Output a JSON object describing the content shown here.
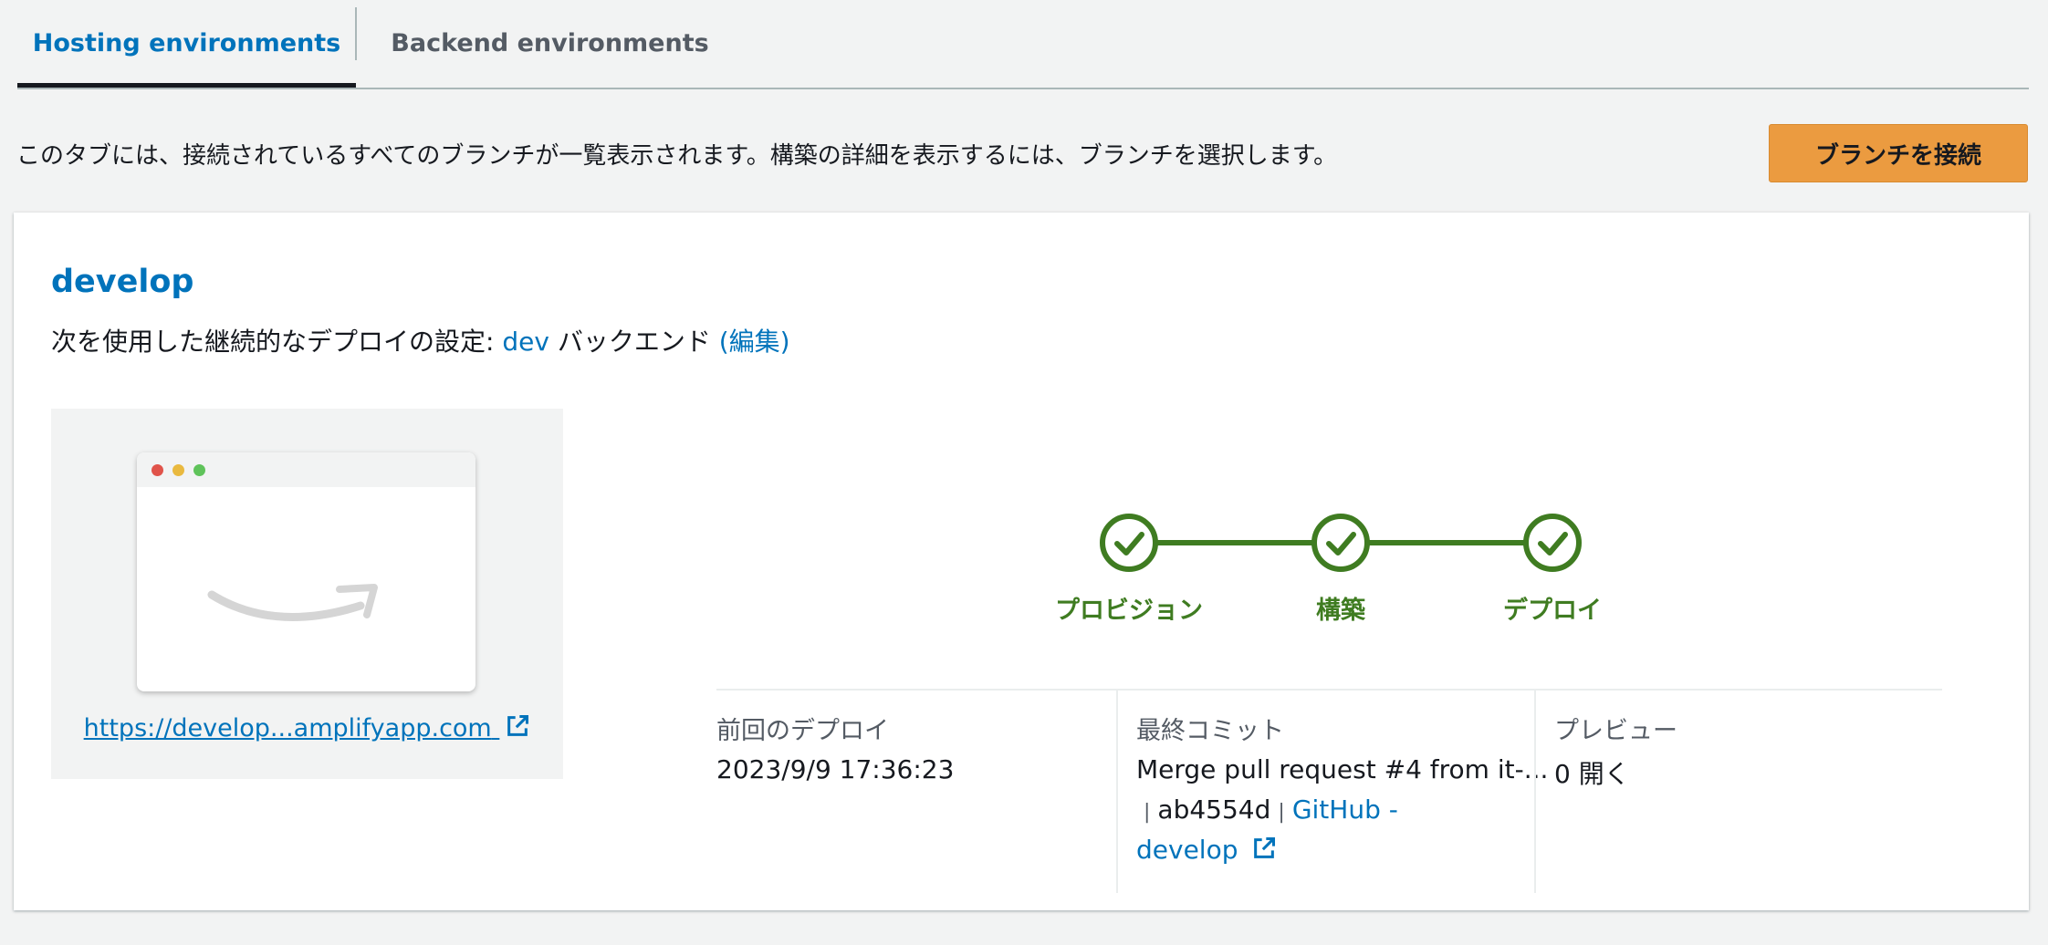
{
  "tabs": {
    "hosting_label": "Hosting environments",
    "backend_label": "Backend environments"
  },
  "intro_text": "このタブには、接続されているすべてのブランチが一覧表示されます。構築の詳細を表示するには、ブランチを選択します。",
  "connect_branch_label": "ブランチを接続",
  "branch": {
    "name": "develop",
    "deploy_prefix": "次を使用した継続的なデプロイの設定: ",
    "backend_link": "dev",
    "backend_suffix": " バックエンド ",
    "edit_label": "(編集)"
  },
  "preview": {
    "url": "https://develop...amplifyapp.com",
    "icon": "external-link-icon"
  },
  "pipeline": {
    "steps": [
      {
        "label": "プロビジョン",
        "status": "success"
      },
      {
        "label": "構築",
        "status": "success"
      },
      {
        "label": "デプロイ",
        "status": "success"
      }
    ],
    "color": "#3f7c21"
  },
  "details": {
    "last_deploy_label": "前回のデプロイ",
    "last_deploy_value": "2023/9/9 17:36:23",
    "last_commit_label": "最終コミット",
    "commit_message": "Merge pull request #4 from it-...",
    "commit_hash": "ab4554d",
    "commit_source_line1": "GitHub -",
    "commit_source_line2": "develop",
    "preview_label": "プレビュー",
    "preview_value": "0 開く"
  },
  "colors": {
    "link": "#0073bb",
    "primary_button": "#eb9b40",
    "success": "#3f7c21"
  }
}
